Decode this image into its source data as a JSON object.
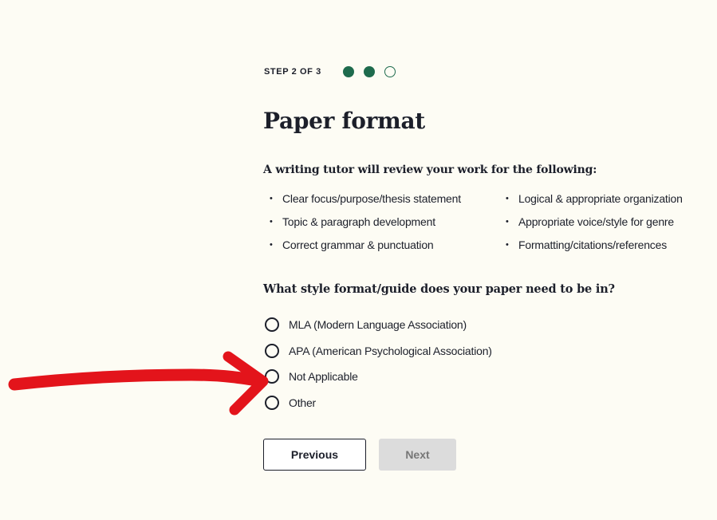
{
  "progress": {
    "step_label": "STEP 2 OF 3",
    "current_step": 2,
    "total_steps": 3,
    "active_color": "#1e6b4d"
  },
  "page": {
    "title": "Paper format"
  },
  "review": {
    "heading": "A writing tutor will review your work for the following:",
    "criteria": [
      "Clear focus/purpose/thesis statement",
      "Logical & appropriate organization",
      "Topic & paragraph development",
      "Appropriate voice/style for genre",
      "Correct grammar & punctuation",
      "Formatting/citations/references"
    ]
  },
  "style_question": {
    "label": "What style format/guide does your paper need to be in?",
    "options": [
      {
        "label": "MLA (Modern Language Association)",
        "selected": false
      },
      {
        "label": "APA (American Psychological Association)",
        "selected": false
      },
      {
        "label": "Not Applicable",
        "selected": false
      },
      {
        "label": "Other",
        "selected": false
      }
    ]
  },
  "buttons": {
    "previous": "Previous",
    "next": "Next",
    "next_disabled": true
  },
  "annotation": {
    "color": "#e3141b",
    "icon": "arrow-icon"
  }
}
